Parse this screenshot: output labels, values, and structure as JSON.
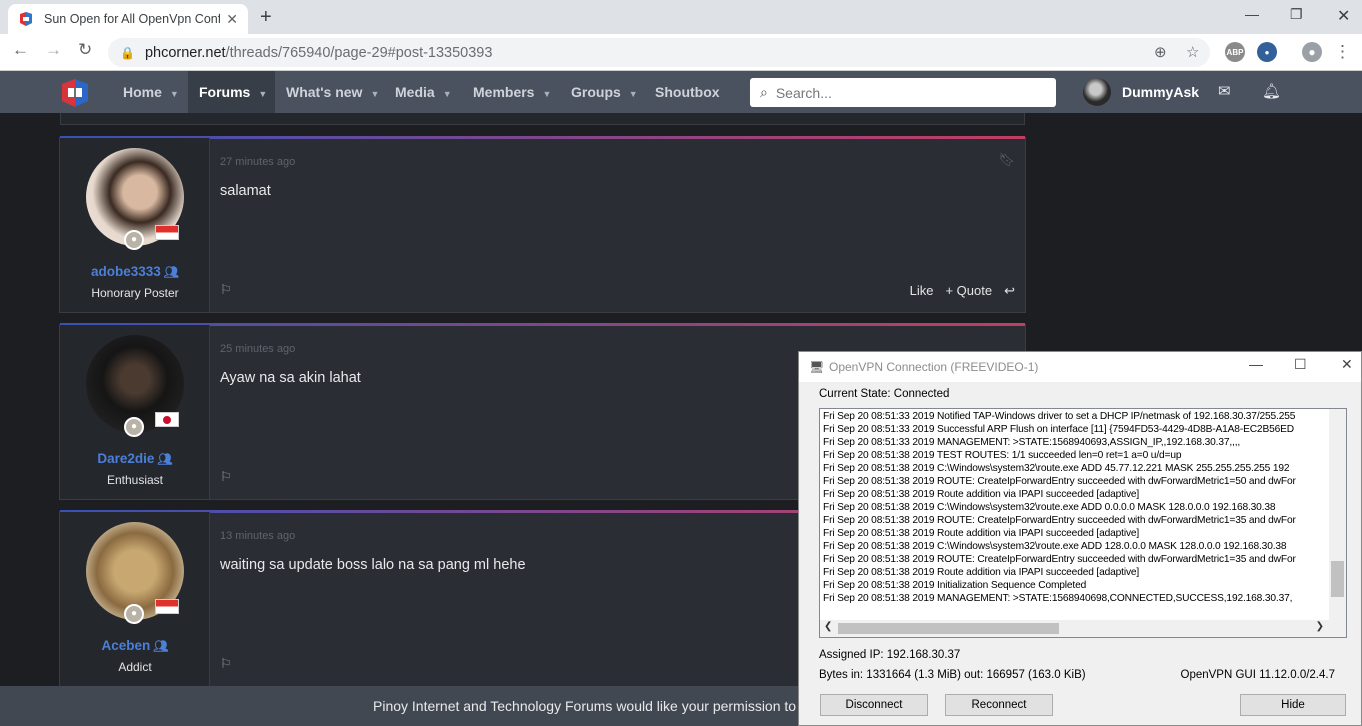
{
  "browser": {
    "tab_title": "Sun Open for All OpenVpn Config",
    "tab_close": "✕",
    "new_tab": "+",
    "url_host": "phcorner.net",
    "url_path": "/threads/765940/page-29#post-13350393",
    "extensions": [
      "ABP"
    ]
  },
  "site": {
    "nav": [
      {
        "label": "Home",
        "caret": true
      },
      {
        "label": "Forums",
        "caret": true,
        "active": true
      },
      {
        "label": "What's new",
        "caret": true
      },
      {
        "label": "Media",
        "caret": true
      },
      {
        "label": "Members",
        "caret": true
      },
      {
        "label": "Groups",
        "caret": true
      },
      {
        "label": "Shoutbox",
        "caret": false
      }
    ],
    "search_placeholder": "Search...",
    "username": "DummyAsk"
  },
  "posts": [
    {
      "time": "27 minutes ago",
      "message": "salamat",
      "username": "adobe3333",
      "rank": "Honorary Poster",
      "flag": "sg",
      "actions": [
        "Like",
        "+ Quote"
      ]
    },
    {
      "time": "25 minutes ago",
      "message": "Ayaw na sa akin lahat",
      "username": "Dare2die",
      "rank": "Enthusiast",
      "flag": "jp"
    },
    {
      "time": "13 minutes ago",
      "message": "waiting sa update boss lalo na sa pang ml hehe",
      "username": "Aceben",
      "rank": "Addict",
      "flag": "sg"
    }
  ],
  "cookie_text": "Pinoy Internet and Technology Forums would like your permission to",
  "vpn": {
    "title": "OpenVPN Connection (FREEVIDEO-1)",
    "state": "Current State: Connected",
    "log": [
      "Fri Sep 20 08:51:33 2019 Notified TAP-Windows driver to set a DHCP IP/netmask of 192.168.30.37/255.255",
      "Fri Sep 20 08:51:33 2019 Successful ARP Flush on interface [11] {7594FD53-4429-4D8B-A1A8-EC2B56ED",
      "Fri Sep 20 08:51:33 2019 MANAGEMENT: >STATE:1568940693,ASSIGN_IP,,192.168.30.37,,,,",
      "Fri Sep 20 08:51:38 2019 TEST ROUTES: 1/1 succeeded len=0 ret=1 a=0 u/d=up",
      "Fri Sep 20 08:51:38 2019 C:\\Windows\\system32\\route.exe ADD 45.77.12.221 MASK 255.255.255.255 192",
      "Fri Sep 20 08:51:38 2019 ROUTE: CreateIpForwardEntry succeeded with dwForwardMetric1=50 and dwFor",
      "Fri Sep 20 08:51:38 2019 Route addition via IPAPI succeeded [adaptive]",
      "Fri Sep 20 08:51:38 2019 C:\\Windows\\system32\\route.exe ADD 0.0.0.0 MASK 128.0.0.0 192.168.30.38",
      "Fri Sep 20 08:51:38 2019 ROUTE: CreateIpForwardEntry succeeded with dwForwardMetric1=35 and dwFor",
      "Fri Sep 20 08:51:38 2019 Route addition via IPAPI succeeded [adaptive]",
      "Fri Sep 20 08:51:38 2019 C:\\Windows\\system32\\route.exe ADD 128.0.0.0 MASK 128.0.0.0 192.168.30.38",
      "Fri Sep 20 08:51:38 2019 ROUTE: CreateIpForwardEntry succeeded with dwForwardMetric1=35 and dwFor",
      "Fri Sep 20 08:51:38 2019 Route addition via IPAPI succeeded [adaptive]",
      "Fri Sep 20 08:51:38 2019 Initialization Sequence Completed",
      "Fri Sep 20 08:51:38 2019 MANAGEMENT: >STATE:1568940698,CONNECTED,SUCCESS,192.168.30.37,"
    ],
    "assigned_ip": "Assigned IP: 192.168.30.37",
    "bytes": "Bytes in: 1331664 (1.3 MiB)  out: 166957 (163.0 KiB)",
    "version": "OpenVPN GUI 11.12.0.0/2.4.7",
    "buttons": {
      "disconnect": "Disconnect",
      "reconnect": "Reconnect",
      "hide": "Hide"
    }
  }
}
